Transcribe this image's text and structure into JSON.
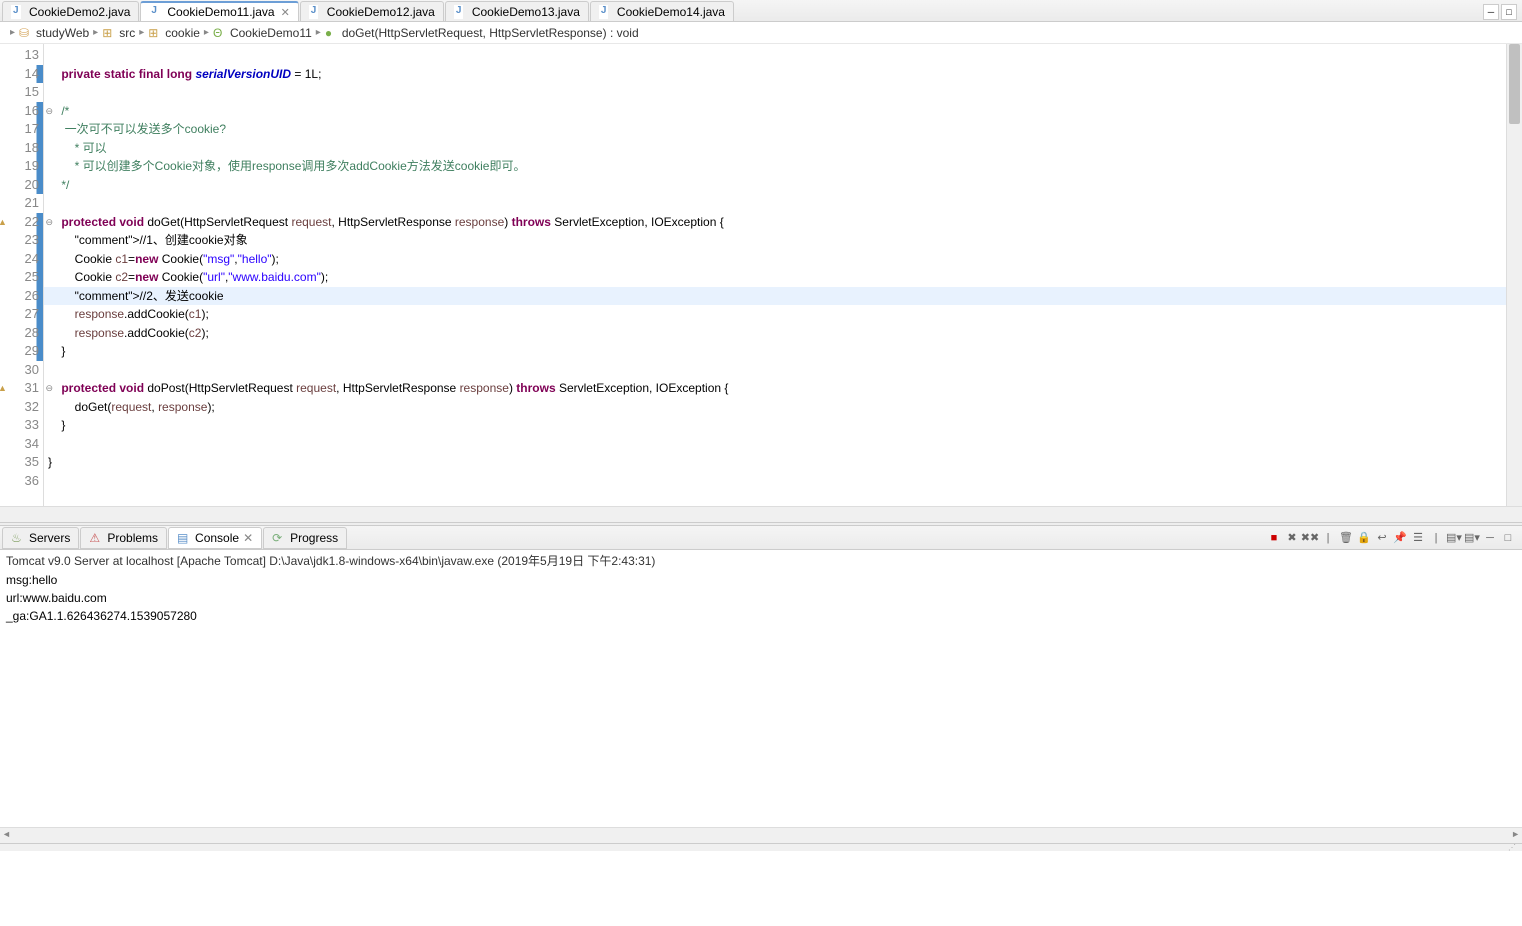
{
  "tabs": [
    {
      "label": "CookieDemo2.java",
      "active": false
    },
    {
      "label": "CookieDemo11.java",
      "active": true
    },
    {
      "label": "CookieDemo12.java",
      "active": false
    },
    {
      "label": "CookieDemo13.java",
      "active": false
    },
    {
      "label": "CookieDemo14.java",
      "active": false
    }
  ],
  "breadcrumb": {
    "project": "studyWeb",
    "source": "src",
    "package": "cookie",
    "class": "CookieDemo11",
    "method": "doGet(HttpServletRequest, HttpServletResponse) : void"
  },
  "code_lines": [
    {
      "n": 13,
      "t": ""
    },
    {
      "n": 14,
      "t": "    private static final long serialVersionUID = 1L;",
      "mod": true
    },
    {
      "n": 15,
      "t": ""
    },
    {
      "n": 16,
      "t": "    /*",
      "fold": true,
      "mod": true
    },
    {
      "n": 17,
      "t": "     一次可不可以发送多个cookie?",
      "mod": true
    },
    {
      "n": 18,
      "t": "        * 可以",
      "mod": true
    },
    {
      "n": 19,
      "t": "        * 可以创建多个Cookie对象，使用response调用多次addCookie方法发送cookie即可。",
      "mod": true
    },
    {
      "n": 20,
      "t": "    */",
      "mod": true
    },
    {
      "n": 21,
      "t": ""
    },
    {
      "n": 22,
      "t": "    protected void doGet(HttpServletRequest request, HttpServletResponse response) throws ServletException, IOException {",
      "fold": true,
      "mod": true,
      "warn": true
    },
    {
      "n": 23,
      "t": "        //1、创建cookie对象",
      "mod": true
    },
    {
      "n": 24,
      "t": "        Cookie c1=new Cookie(\"msg\",\"hello\");",
      "mod": true
    },
    {
      "n": 25,
      "t": "        Cookie c2=new Cookie(\"url\",\"www.baidu.com\");",
      "mod": true
    },
    {
      "n": 26,
      "t": "        //2、发送cookie",
      "mod": true,
      "hl": true
    },
    {
      "n": 27,
      "t": "        response.addCookie(c1);",
      "mod": true
    },
    {
      "n": 28,
      "t": "        response.addCookie(c2);",
      "mod": true
    },
    {
      "n": 29,
      "t": "    }",
      "mod": true
    },
    {
      "n": 30,
      "t": ""
    },
    {
      "n": 31,
      "t": "    protected void doPost(HttpServletRequest request, HttpServletResponse response) throws ServletException, IOException {",
      "fold": true,
      "warn": true
    },
    {
      "n": 32,
      "t": "        doGet(request, response);"
    },
    {
      "n": 33,
      "t": "    }"
    },
    {
      "n": 34,
      "t": ""
    },
    {
      "n": 35,
      "t": "}"
    },
    {
      "n": 36,
      "t": ""
    }
  ],
  "bottom_tabs": [
    {
      "label": "Servers",
      "active": false
    },
    {
      "label": "Problems",
      "active": false
    },
    {
      "label": "Console",
      "active": true
    },
    {
      "label": "Progress",
      "active": false
    }
  ],
  "console": {
    "header": "Tomcat v9.0 Server at localhost [Apache Tomcat] D:\\Java\\jdk1.8-windows-x64\\bin\\javaw.exe (2019年5月19日 下午2:43:31)",
    "lines": [
      "msg:hello",
      "url:www.baidu.com",
      "_ga:GA1.1.626436274.1539057280"
    ]
  }
}
